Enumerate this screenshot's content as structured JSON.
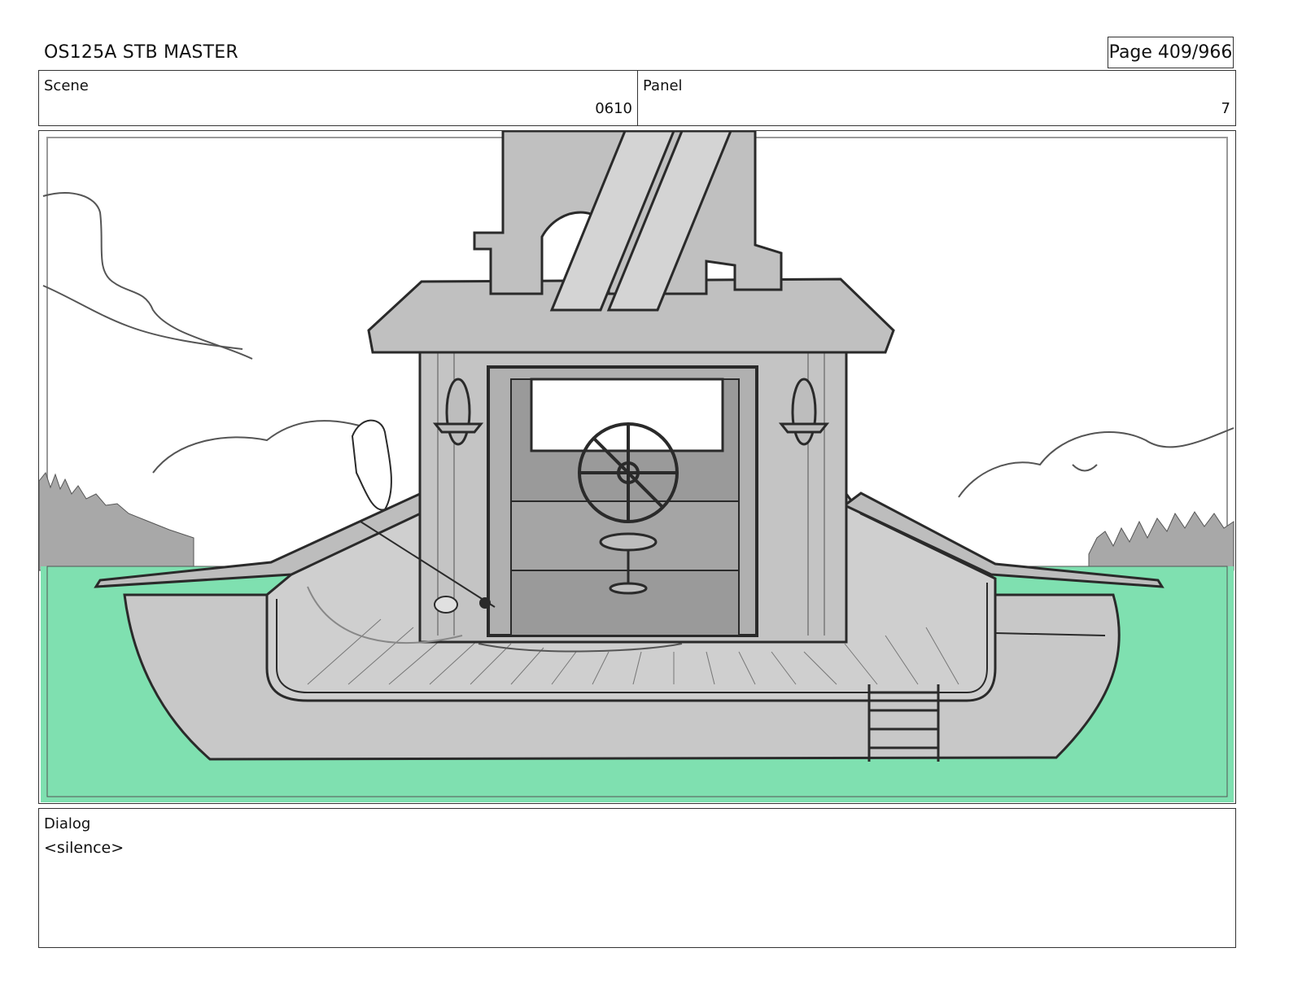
{
  "header": {
    "title": "OS125A  STB MASTER",
    "page_label": "Page 409/966"
  },
  "scene": {
    "label": "Scene",
    "value": "0610"
  },
  "panel": {
    "label": "Panel",
    "value": "7"
  },
  "dialog": {
    "label": "Dialog",
    "text": "<silence>"
  },
  "colors": {
    "water": "#7fe0b0",
    "boat": "#c8c8c8",
    "trees": "#a8a8a8",
    "ink": "#2a2a2a"
  }
}
